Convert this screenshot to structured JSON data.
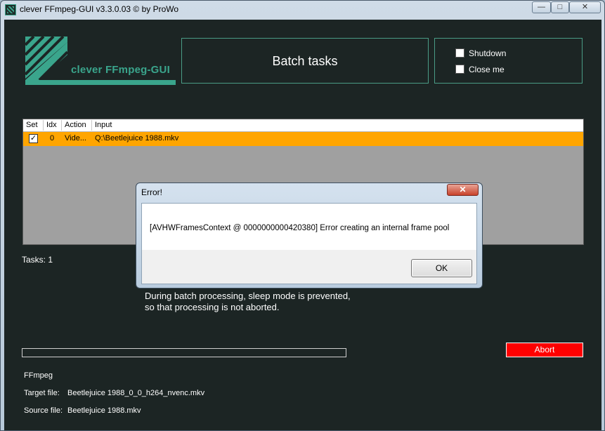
{
  "window": {
    "title": "clever FFmpeg-GUI v3.3.0.03   © by ProWo",
    "controls": {
      "minimize": "—",
      "maximize": "□",
      "close": "✕"
    }
  },
  "logo": {
    "text": "clever FFmpeg-GUI",
    "icon": "app-logo"
  },
  "header": {
    "title": "Batch tasks"
  },
  "options": {
    "shutdown": {
      "label": "Shutdown",
      "checked": false
    },
    "close_me": {
      "label": "Close me",
      "checked": false
    }
  },
  "task_table": {
    "columns": [
      "Set",
      "Idx",
      "Action",
      "Input"
    ],
    "rows": [
      {
        "set": "✓",
        "idx": "0",
        "action": "Vide...",
        "input": "Q:\\Beetlejuice 1988.mkv",
        "highlight": "#ffa500"
      }
    ]
  },
  "tasks": {
    "label": "Tasks:",
    "count": "1"
  },
  "sleep_note": {
    "line1": "During batch processing, sleep mode is prevented,",
    "line2": "so that processing is not aborted."
  },
  "progress": {
    "value": 0
  },
  "abort_button": {
    "label": "Abort",
    "color": "#ff0000"
  },
  "info": {
    "engine": "FFmpeg",
    "target_label": "Target file:",
    "target_value": "Beetlejuice 1988_0_0_h264_nvenc.mkv",
    "source_label": "Source file:",
    "source_value": "Beetlejuice 1988.mkv"
  },
  "error_dialog": {
    "title": "Error!",
    "message": "[AVHWFramesContext @ 0000000000420380] Error creating an internal frame pool",
    "ok_label": "OK",
    "close_glyph": "✕"
  },
  "colors": {
    "accent": "#3aa58c",
    "background": "#1c2524",
    "row_highlight": "#ffa500"
  }
}
